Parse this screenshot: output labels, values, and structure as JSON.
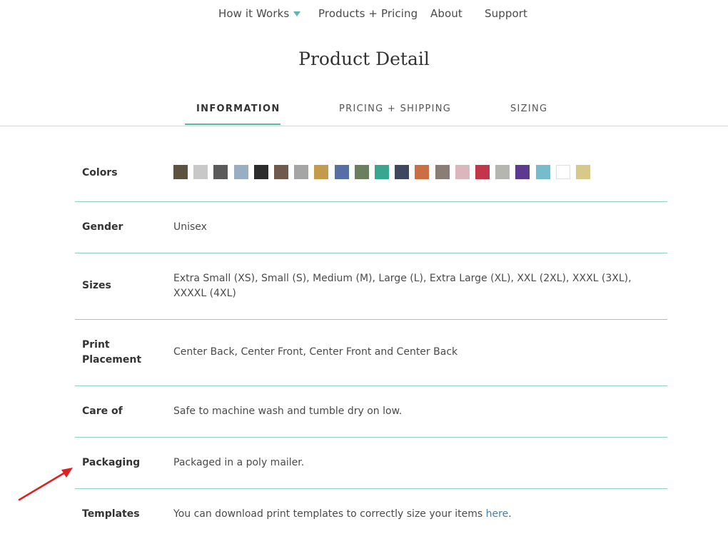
{
  "nav": {
    "items": [
      {
        "label": "How it Works"
      },
      {
        "label": "Products + Pricing"
      },
      {
        "label": "About"
      },
      {
        "label": "Support"
      }
    ]
  },
  "page": {
    "title": "Product Detail"
  },
  "tabs": [
    {
      "label": "INFORMATION",
      "active": true
    },
    {
      "label": "PRICING + SHIPPING",
      "active": false
    },
    {
      "label": "SIZING",
      "active": false
    }
  ],
  "details": {
    "colors": {
      "label": "Colors",
      "swatches": [
        "#5b5340",
        "#c8c8c8",
        "#5a5a5a",
        "#9aaec3",
        "#2c2c2c",
        "#705a4b",
        "#a5a5a5",
        "#c49a4c",
        "#5470a6",
        "#6a7f5c",
        "#3aa690",
        "#3f4760",
        "#cc6e44",
        "#8a7d76",
        "#dbb6bd",
        "#c33548",
        "#b6b6b0",
        "#5c3a8e",
        "#76bccd",
        "#ffffff",
        "#d6c98a"
      ]
    },
    "gender": {
      "label": "Gender",
      "value": "Unisex"
    },
    "sizes": {
      "label": "Sizes",
      "value": "Extra Small (XS), Small (S), Medium (M), Large (L), Extra Large (XL), XXL (2XL), XXXL (3XL), XXXXL (4XL)"
    },
    "print_placement": {
      "label": "Print Placement",
      "value": "Center Back, Center Front, Center Front and Center Back"
    },
    "care": {
      "label": "Care of",
      "value": "Safe to machine wash and tumble dry on low."
    },
    "packaging": {
      "label": "Packaging",
      "value": "Packaged in a poly mailer."
    },
    "templates": {
      "label": "Templates",
      "value": "You can download print templates to correctly size your items ",
      "link": "here",
      "suffix": "."
    }
  },
  "colors": {
    "accent": "#5bb8a8",
    "link": "#3e7fb8",
    "annotation": "#e02020"
  }
}
